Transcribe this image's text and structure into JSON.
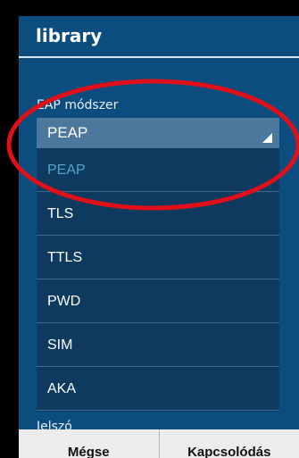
{
  "dialog": {
    "title": "library"
  },
  "form": {
    "eap_label": "EAP módszer",
    "eap_selected": "PEAP",
    "password_label": "Jelszó"
  },
  "dropdown": {
    "options": [
      {
        "label": "PEAP",
        "selected": true
      },
      {
        "label": "TLS",
        "selected": false
      },
      {
        "label": "TTLS",
        "selected": false
      },
      {
        "label": "PWD",
        "selected": false
      },
      {
        "label": "SIM",
        "selected": false
      },
      {
        "label": "AKA",
        "selected": false
      }
    ]
  },
  "buttons": {
    "cancel_label": "Mégse",
    "connect_label": "Kapcsolódás"
  },
  "colors": {
    "dialog_bg": "#0c4d80",
    "list_bg": "#0d3a5e",
    "selected_text": "#4fa6c8",
    "annotation": "#e0101a"
  }
}
